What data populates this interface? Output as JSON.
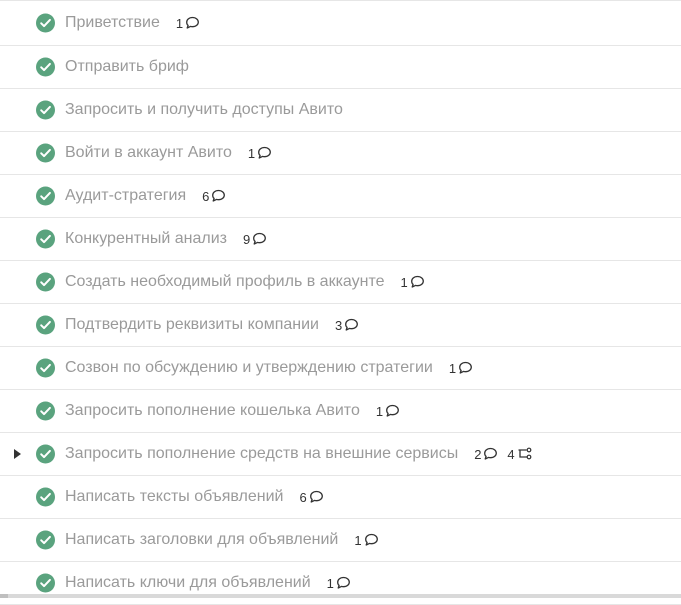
{
  "tasks": [
    {
      "title": "Приветствие",
      "comments": "1"
    },
    {
      "title": "Отправить бриф"
    },
    {
      "title": "Запросить и получить доступы Авито"
    },
    {
      "title": "Войти в аккаунт Авито",
      "comments": "1"
    },
    {
      "title": "Аудит-стратегия",
      "comments": "6"
    },
    {
      "title": "Конкурентный анализ",
      "comments": "9"
    },
    {
      "title": "Создать необходимый профиль в аккаунте",
      "comments": "1"
    },
    {
      "title": "Подтвердить реквизиты компании",
      "comments": "3"
    },
    {
      "title": "Созвон по обсуждению и утверждению стратегии",
      "comments": "1"
    },
    {
      "title": "Запросить пополнение кошелька Авито",
      "comments": "1"
    },
    {
      "title": "Запросить пополнение средств на внешние сервисы",
      "comments": "2",
      "subtasks": "4",
      "expandable": true
    },
    {
      "title": "Написать тексты объявлений",
      "comments": "6"
    },
    {
      "title": "Написать заголовки для объявлений",
      "comments": "1"
    },
    {
      "title": "Написать ключи для объявлений",
      "comments": "1"
    }
  ],
  "icons": {
    "status": "check-circle-icon",
    "comment": "comment-bubble-icon",
    "subtask": "subtask-icon",
    "expand": "caret-right-icon"
  },
  "colors": {
    "done_green": "#5aa37e",
    "completed_text": "#9a9a9a",
    "count_text": "#333333",
    "divider": "#e6e6e6"
  }
}
